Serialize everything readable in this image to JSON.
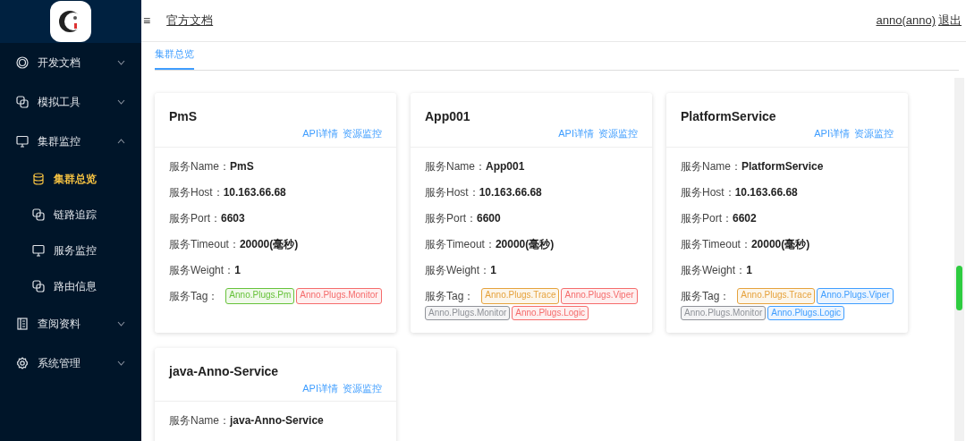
{
  "sidebar": {
    "items": [
      {
        "label": "开发文档",
        "expanded": false
      },
      {
        "label": "模拟工具",
        "expanded": false
      },
      {
        "label": "集群监控",
        "expanded": true,
        "children": [
          {
            "label": "集群总览",
            "selected": true
          },
          {
            "label": "链路追踪",
            "selected": false
          },
          {
            "label": "服务监控",
            "selected": false
          },
          {
            "label": "路由信息",
            "selected": false
          }
        ]
      },
      {
        "label": "查阅资料",
        "expanded": false
      },
      {
        "label": "系统管理",
        "expanded": false
      }
    ]
  },
  "header": {
    "menu_glyph": "≡",
    "doc_link": "官方文档",
    "user": "anno(anno)",
    "logout": "退出"
  },
  "tabs": [
    {
      "label": "集群总览",
      "selected": true
    }
  ],
  "cards": [
    {
      "title": "PmS",
      "links": [
        "API详情",
        "资源监控"
      ],
      "fields": [
        {
          "label": "服务Name：",
          "value": "PmS"
        },
        {
          "label": "服务Host：",
          "value": "10.163.66.68"
        },
        {
          "label": "服务Port：",
          "value": "6603"
        },
        {
          "label": "服务Timeout：",
          "value": "20000(毫秒)"
        },
        {
          "label": "服务Weight：",
          "value": "1"
        }
      ],
      "tag_label": "服务Tag：",
      "tags": [
        {
          "text": "Anno.Plugs.Pm",
          "color": "#67c23a"
        },
        {
          "text": "Anno.Plugs.Monitor",
          "color": "#f56c6c"
        }
      ]
    },
    {
      "title": "App001",
      "links": [
        "API详情",
        "资源监控"
      ],
      "fields": [
        {
          "label": "服务Name：",
          "value": "App001"
        },
        {
          "label": "服务Host：",
          "value": "10.163.66.68"
        },
        {
          "label": "服务Port：",
          "value": "6600"
        },
        {
          "label": "服务Timeout：",
          "value": "20000(毫秒)"
        },
        {
          "label": "服务Weight：",
          "value": "1"
        }
      ],
      "tag_label": "服务Tag：",
      "tags": [
        {
          "text": "Anno.Plugs.Trace",
          "color": "#e6a23c"
        },
        {
          "text": "Anno.Plugs.Viper",
          "color": "#f56c6c"
        },
        {
          "text": "Anno.Plugs.Monitor",
          "color": "#909399"
        },
        {
          "text": "Anno.Plugs.Logic",
          "color": "#f56c6c"
        }
      ]
    },
    {
      "title": "PlatformService",
      "links": [
        "API详情",
        "资源监控"
      ],
      "fields": [
        {
          "label": "服务Name：",
          "value": "PlatformService"
        },
        {
          "label": "服务Host：",
          "value": "10.163.66.68"
        },
        {
          "label": "服务Port：",
          "value": "6602"
        },
        {
          "label": "服务Timeout：",
          "value": "20000(毫秒)"
        },
        {
          "label": "服务Weight：",
          "value": "1"
        }
      ],
      "tag_label": "服务Tag：",
      "tags": [
        {
          "text": "Anno.Plugs.Trace",
          "color": "#e6a23c"
        },
        {
          "text": "Anno.Plugs.Viper",
          "color": "#409eff"
        },
        {
          "text": "Anno.Plugs.Monitor",
          "color": "#909399"
        },
        {
          "text": "Anno.Plugs.Logic",
          "color": "#409eff"
        }
      ]
    },
    {
      "title": "java-Anno-Service",
      "links": [
        "API详情",
        "资源监控"
      ],
      "fields": [
        {
          "label": "服务Name：",
          "value": "java-Anno-Service"
        }
      ]
    }
  ]
}
